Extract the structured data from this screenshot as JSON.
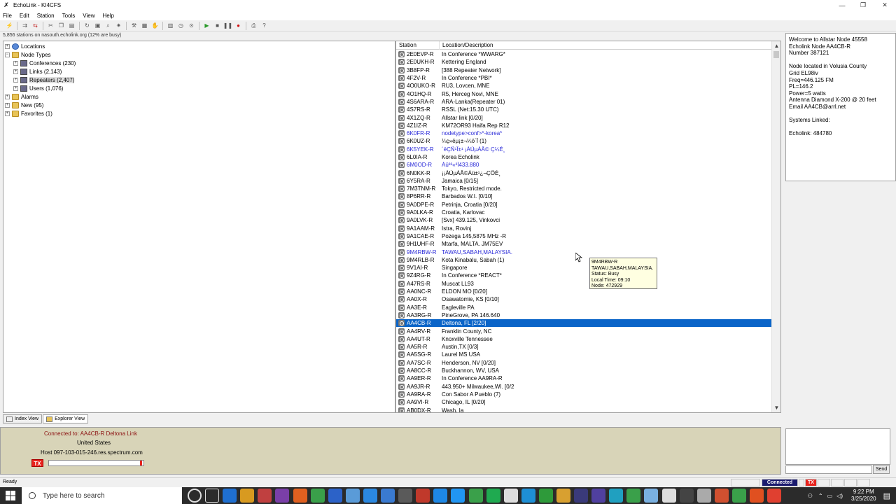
{
  "window": {
    "title": "EchoLink - KI4CFS",
    "icon": "echolink-icon"
  },
  "menu": [
    "File",
    "Edit",
    "Station",
    "Tools",
    "View",
    "Help"
  ],
  "status_line": "5,856 stations on nasouth.echolink.org (12% are busy)",
  "tree": {
    "locations": "Locations",
    "node_types": "Node Types",
    "conferences": "Conferences (230)",
    "links": "Links (2,143)",
    "repeaters": "Repeaters (2,407)",
    "users": "Users (1,076)",
    "alarms": "Alarms",
    "new": "New (95)",
    "favorites": "Favorites (1)"
  },
  "list": {
    "columns": [
      "Station",
      "Location/Description"
    ],
    "rows": [
      [
        "2E0EVP-R",
        "In Conference *WWARG*",
        ""
      ],
      [
        "2E0UKH-R",
        "Kettering England",
        ""
      ],
      [
        "3B8FP-R",
        "[388 Repeater Network]",
        ""
      ],
      [
        "4F2V-R",
        "In Conference *PBI*",
        ""
      ],
      [
        "4O0UKO-R",
        "RU3, Lovcen, MNE",
        ""
      ],
      [
        "4O1HQ-R",
        "R5, Herceg Novi, MNE",
        ""
      ],
      [
        "4S6ARA-R",
        "ARA-Lanka(Repeater 01)",
        ""
      ],
      [
        "4S7RS-R",
        "RSSL (Net:15.30 UTC)",
        ""
      ],
      [
        "4X1ZQ-R",
        "Allstar link [0/20]",
        ""
      ],
      [
        "4Z1IZ-R",
        "KM72OR93 Haifa Rep R12",
        ""
      ],
      [
        "6K0FR-R",
        "nodetype>conf>*-korea*",
        "blue"
      ],
      [
        "6K0UZ-R",
        "¼ç»ëµ¡±¬¼ö´Ï (1)",
        ""
      ],
      [
        "6K5YEK-R",
        "´ëÇÑ¹Î±¹ ¡ÀÚµÁÂ© Ç¼É¸",
        "blue"
      ],
      [
        "6L0IA-R",
        "Korea Echolink",
        ""
      ],
      [
        "6M0OD-R",
        "Àü³²«²Ì433.880",
        "blue"
      ],
      [
        "6N0KK-R",
        "¡¡ÀÚµÁÂ©Àü±¹¿¬ÇÕÉ¸",
        ""
      ],
      [
        "6Y5RA-R",
        "Jamaica [0/15]",
        ""
      ],
      [
        "7M3TNM-R",
        "Tokyo, Restricted mode.",
        ""
      ],
      [
        "8P6RR-R",
        "Barbados W.I. [0/10]",
        ""
      ],
      [
        "9A0DPE-R",
        "Petrinja, Croatia [0/20]",
        ""
      ],
      [
        "9A0LKA-R",
        "Croatia, Karlovac",
        ""
      ],
      [
        "9A0LVK-R",
        "[Svx] 439.125, Vinkovci",
        ""
      ],
      [
        "9A1AAM-R",
        "Istra, Rovinj",
        ""
      ],
      [
        "9A1CAE-R",
        "Pozega 145,5875 MHz -R",
        ""
      ],
      [
        "9H1UHF-R",
        "Mtarfa, MALTA. JM75EV",
        ""
      ],
      [
        "9M4RBW-R",
        "TAWAU,SABAH,MALAYSIA.",
        "blue"
      ],
      [
        "9M4RLB-R",
        "Kota Kinabalu, Sabah (1)",
        ""
      ],
      [
        "9V1AI-R",
        "Singapore",
        ""
      ],
      [
        "9Z4RG-R",
        "In Conference *REACT*",
        ""
      ],
      [
        "A47RS-R",
        "Muscat LL93",
        ""
      ],
      [
        "AA0NC-R",
        "ELDON MO [0/20]",
        ""
      ],
      [
        "AA0X-R",
        "Osawatomie, KS [0/10]",
        ""
      ],
      [
        "AA3E-R",
        "Eagleville PA",
        ""
      ],
      [
        "AA3RG-R",
        "PineGrove, PA 146.640",
        ""
      ],
      [
        "AA4CB-R",
        "Deltona, FL [2/20]",
        "sel"
      ],
      [
        "AA4RV-R",
        "Franklin County, NC",
        ""
      ],
      [
        "AA4UT-R",
        "Knoxville Tennessee",
        ""
      ],
      [
        "AA5R-R",
        "Austin,TX [0/3]",
        ""
      ],
      [
        "AA5SG-R",
        "Laurel MS USA",
        ""
      ],
      [
        "AA7SC-R",
        "Henderson, NV [0/20]",
        ""
      ],
      [
        "AA8CC-R",
        "Buckhannon, WV, USA",
        ""
      ],
      [
        "AA9ER-R",
        "In Conference AA9RA-R",
        ""
      ],
      [
        "AA9JR-R",
        "443.950+ Milwaukee,WI. [0/2",
        ""
      ],
      [
        "AA9RA-R",
        "Con Sabor A Pueblo (7)",
        ""
      ],
      [
        "AA9VI-R",
        "Chicago, IL [0/20]",
        ""
      ],
      [
        "AB0DX-R",
        "Wash, Ia",
        ""
      ]
    ]
  },
  "tooltip": [
    "9M4RBW-R",
    "TAWAU,SABAH,MALAYSIA.",
    "Status: Busy",
    "Local Time: 09:10",
    "Node: 472929"
  ],
  "info_panel": "Welcome to Allstar Node 45558\nEcholink Node AA4CB-R\nNumber 387121\n\nNode located in Volusia County\nGrid EL98iv\nFreq=446.125 FM\nPL=146.2\nPower=5 watts\nAntenna Diamond X-200 @ 20 feet\nEmail AA4CB@arrl.net\n\nSystems Linked:\n\nEcholink:  484780",
  "tabs": [
    "Index View",
    "Explorer View"
  ],
  "connection": {
    "line1": "Connected to:  AA4CB-R Deltona Link",
    "line2": "United States",
    "line3": "Host 097-103-015-246.res.spectrum.com",
    "tx": "TX"
  },
  "send_label": "Send",
  "statusbar": {
    "ready": "Ready",
    "connected": "Connected",
    "tx": "TX"
  },
  "taskbar": {
    "search_placeholder": "Type here to search",
    "time": "9:22 PM",
    "date": "3/25/2020",
    "app_colors": [
      "#2b2b2b",
      "#2b2b2b",
      "#1f6fd0",
      "#d89a20",
      "#c04040",
      "#7a3fa8",
      "#e06020",
      "#3aa04a",
      "#2c62c8",
      "#5a9bd8",
      "#2b88e0",
      "#3a7ad0",
      "#5a5a5a",
      "#c0392b",
      "#1e88e5",
      "#2196f3",
      "#3aa04a",
      "#1faa50",
      "#ddd",
      "#1e8fd5",
      "#2e9a3a",
      "#d8a030",
      "#3a3a7a",
      "#5040a0",
      "#20a0c0",
      "#3aa04a",
      "#7ab0e0",
      "#ddd",
      "#444",
      "#aaa",
      "#d05030",
      "#3aa04a",
      "#e05020",
      "#e04030"
    ]
  }
}
